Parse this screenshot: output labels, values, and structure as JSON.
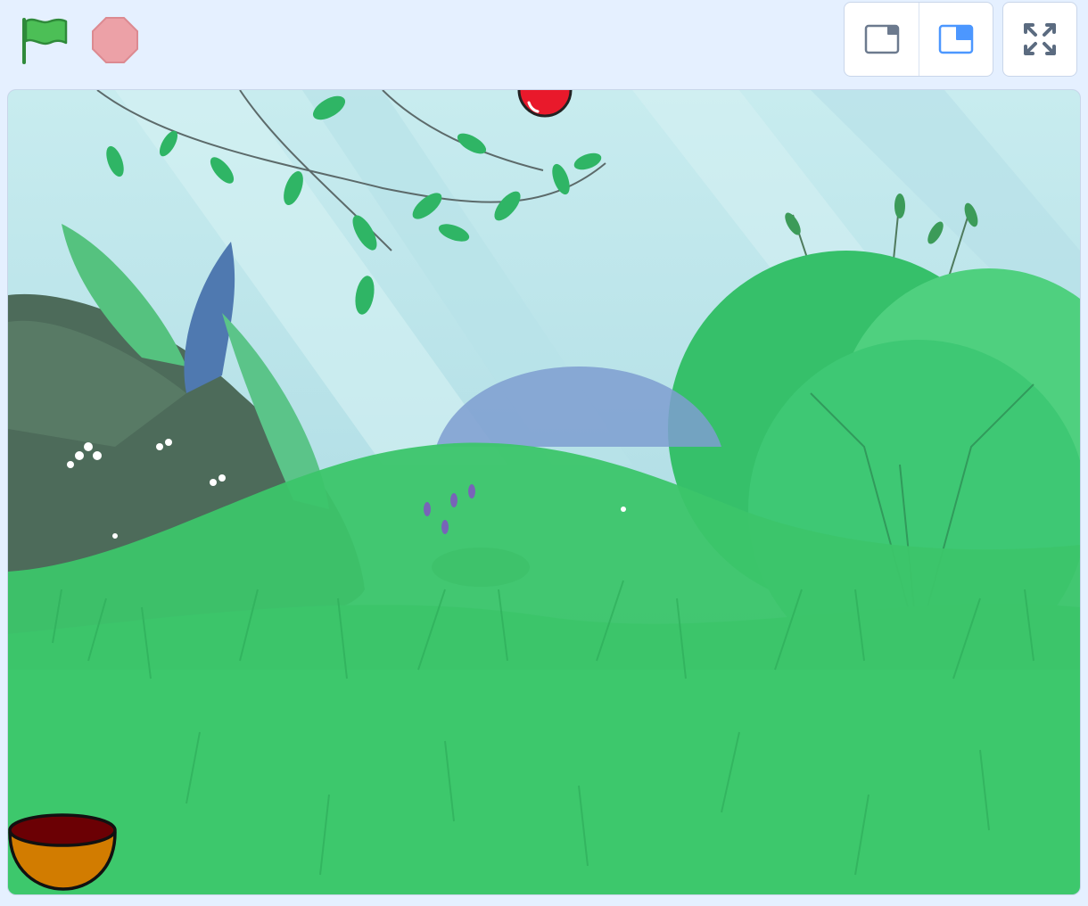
{
  "controls": {
    "green_flag": {
      "icon": "green-flag-icon",
      "color": "#4cbf56"
    },
    "stop": {
      "icon": "stop-sign-icon",
      "color": "#eca1a7"
    }
  },
  "stage_modes": {
    "small_stage": {
      "icon": "small-stage-icon",
      "active": false
    },
    "normal_stage": {
      "icon": "normal-stage-icon",
      "active": true,
      "accent": "#4c97ff"
    },
    "fullscreen": {
      "icon": "fullscreen-icon"
    }
  },
  "stage": {
    "backdrop": "forest",
    "sprites": [
      {
        "name": "Apple",
        "color": "#e9192b"
      },
      {
        "name": "Bowl",
        "color": "#d27c00",
        "inner_color": "#6b0004"
      }
    ]
  }
}
